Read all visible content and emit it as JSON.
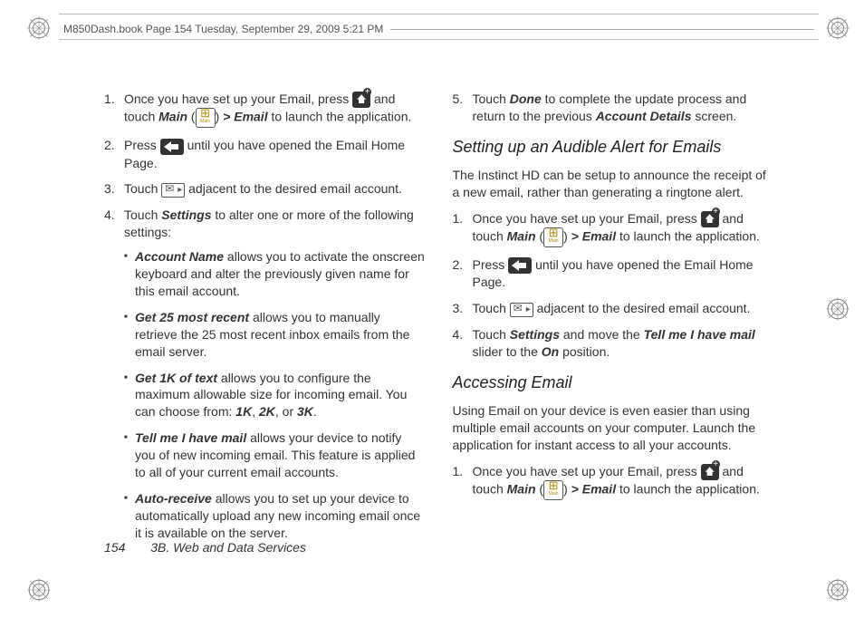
{
  "header": "M850Dash.book  Page 154  Tuesday, September 29, 2009  5:21 PM",
  "footer": {
    "page": "154",
    "section": "3B. Web and Data Services"
  },
  "left": {
    "steps": [
      {
        "num": "1.",
        "pre": "Once you have set up your Email, press ",
        "mid1": " and touch ",
        "main": "Main",
        "paren_open": " (",
        "paren_close": ") ",
        "gt": ">",
        "email": "Email",
        "post": " to launch the application."
      },
      {
        "num": "2.",
        "pre": "Press ",
        "post": " until you have opened the Email Home Page."
      },
      {
        "num": "3.",
        "pre": "Touch ",
        "post": " adjacent to the desired email account."
      },
      {
        "num": "4.",
        "pre": "Touch ",
        "settings": "Settings",
        "post": " to alter one or more of the following settings:",
        "bullets": [
          {
            "term": "Account Name",
            "text": " allows you to activate the onscreen keyboard and alter the previously given name for this email account."
          },
          {
            "term": "Get 25 most recent",
            "text": " allows you to manually retrieve the 25 most recent inbox emails from the email server."
          },
          {
            "term": "Get 1K of text",
            "text": " allows you to configure the maximum allowable size for incoming email. You can choose from: ",
            "opts": [
              "1K",
              "2K",
              "3K"
            ],
            "sep": ", ",
            "or": " or ",
            "end": "."
          },
          {
            "term": "Tell me I have mail",
            "text": " allows your device to notify you of new incoming email. This feature is applied to all of your current email accounts."
          },
          {
            "term": "Auto-receive",
            "text": " allows you to set up your device to automatically upload any new incoming email once it is available on the server."
          }
        ]
      }
    ]
  },
  "right": {
    "step5": {
      "num": "5.",
      "pre": "Touch ",
      "done": "Done",
      "mid": " to complete the update process and return to the previous ",
      "acct": "Account Details",
      "post": " screen."
    },
    "h_audible": "Setting up an Audible Alert for Emails",
    "audible_intro": "The Instinct HD can be setup to announce the receipt of a new email, rather than generating a ringtone alert.",
    "audible_steps": [
      {
        "num": "1.",
        "pre": "Once you have set up your Email, press ",
        "mid1": " and touch ",
        "main": "Main",
        "paren_open": " (",
        "paren_close": ") ",
        "gt": ">",
        "email": "Email",
        "post": " to launch the application."
      },
      {
        "num": "2.",
        "pre": "Press ",
        "post": " until you have opened the Email Home Page."
      },
      {
        "num": "3.",
        "pre": "Touch ",
        "post": " adjacent to the desired email account."
      },
      {
        "num": "4.",
        "pre": "Touch ",
        "settings": "Settings",
        "mid": " and move the ",
        "tell": "Tell me I have mail",
        "mid2": " slider to the ",
        "on": "On",
        "post": " position."
      }
    ],
    "h_access": "Accessing Email",
    "access_intro": "Using Email on your device is even easier than using multiple email accounts on your computer. Launch the application for instant access to all your accounts.",
    "access_steps": [
      {
        "num": "1.",
        "pre": "Once you have set up your Email, press ",
        "mid1": " and touch ",
        "main": "Main",
        "paren_open": " (",
        "paren_close": ") ",
        "gt": ">",
        "email": "Email",
        "post": "  to launch the application."
      }
    ]
  }
}
